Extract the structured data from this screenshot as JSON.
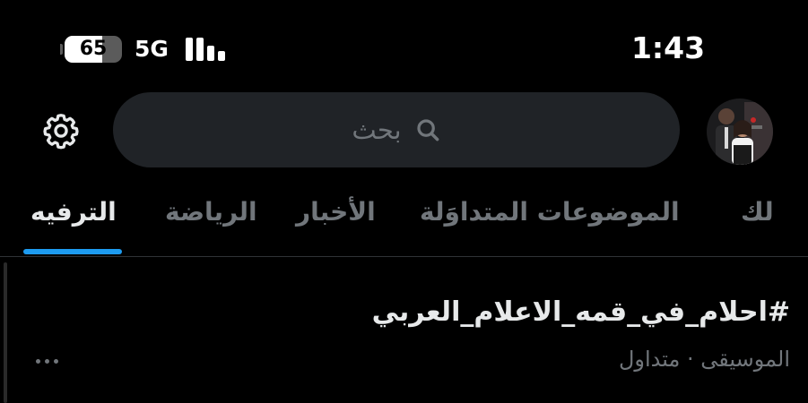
{
  "status_bar": {
    "battery_level": "65",
    "battery_fraction": 0.65,
    "network": "5G",
    "signal_bars": 4,
    "time": "1:43"
  },
  "header": {
    "search": {
      "placeholder": "بحث"
    },
    "icons": {
      "settings": "gear-icon",
      "search": "search-icon",
      "avatar": "profile-avatar"
    }
  },
  "tabs": [
    {
      "label": "لك",
      "active": false
    },
    {
      "label": "الموضوعات المتداوَلة",
      "active": false
    },
    {
      "label": "الأخبار",
      "active": false
    },
    {
      "label": "الرياضة",
      "active": false
    },
    {
      "label": "الترفيه",
      "active": true
    }
  ],
  "feed": {
    "items": [
      {
        "title": "#احلام_في_قمه_الاعلام_العربي",
        "meta": "الموسيقى · متداول"
      }
    ]
  },
  "colors": {
    "background": "#000000",
    "accent": "#1d9bf0",
    "search_bg": "#202327",
    "muted_text": "#71767b",
    "primary_text": "#e7e9ea"
  }
}
